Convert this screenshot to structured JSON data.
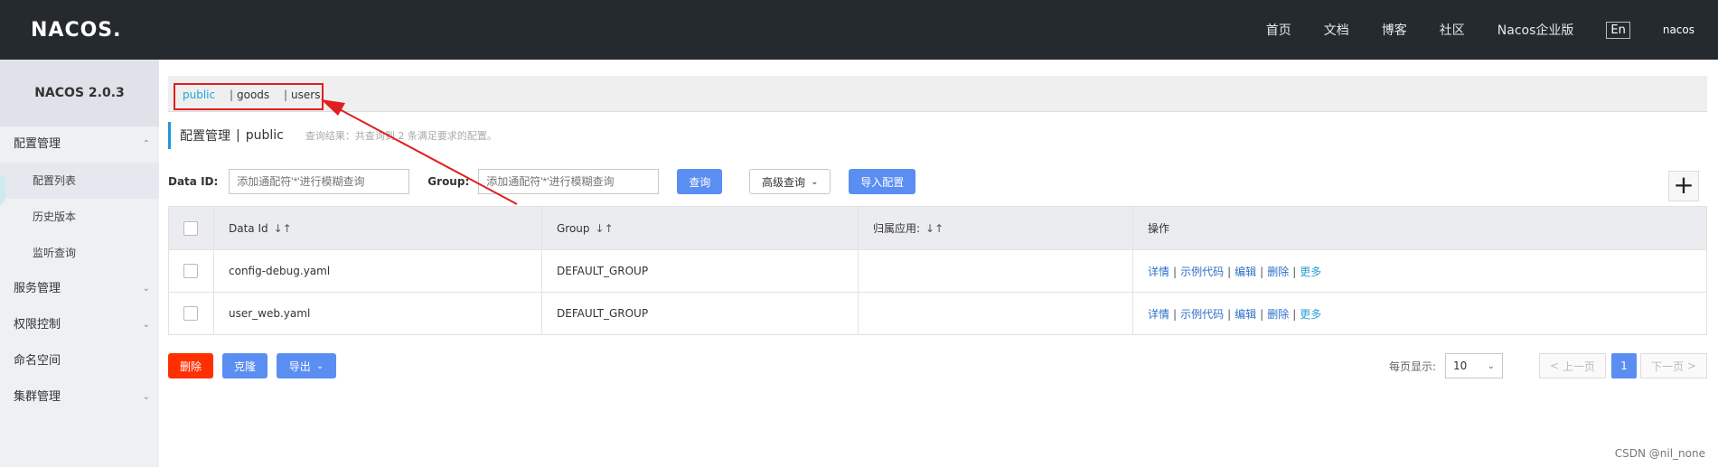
{
  "topbar": {
    "logo": "NACOS.",
    "nav": [
      "首页",
      "文档",
      "博客",
      "社区",
      "Nacos企业版"
    ],
    "lang": "En",
    "user": "nacos"
  },
  "sidebar": {
    "version": "NACOS 2.0.3",
    "config_group": "配置管理",
    "config_items": [
      "配置列表",
      "历史版本",
      "监听查询"
    ],
    "service": "服务管理",
    "auth": "权限控制",
    "namespace": "命名空间",
    "cluster": "集群管理"
  },
  "namespaces": {
    "active": "public",
    "others": [
      "goods",
      "users"
    ]
  },
  "title": {
    "main": "配置管理",
    "sep": "|",
    "ns": "public",
    "hint": "查询结果：共查询到 2 条满足要求的配置。"
  },
  "search": {
    "dataid_label": "Data ID:",
    "dataid_placeholder": "添加通配符'*'进行模糊查询",
    "group_label": "Group:",
    "group_placeholder": "添加通配符'*'进行模糊查询",
    "query_btn": "查询",
    "advanced_btn": "高级查询",
    "import_btn": "导入配置"
  },
  "table": {
    "headers": [
      "Data Id",
      "Group",
      "归属应用:",
      "操作"
    ],
    "rows": [
      {
        "dataid": "config-debug.yaml",
        "group": "DEFAULT_GROUP",
        "app": ""
      },
      {
        "dataid": "user_web.yaml",
        "group": "DEFAULT_GROUP",
        "app": ""
      }
    ],
    "ops": [
      "详情",
      "示例代码",
      "编辑",
      "删除",
      "更多"
    ]
  },
  "bottom": {
    "delete_btn": "删除",
    "clone_btn": "克隆",
    "export_btn": "导出",
    "page_size_label": "每页显示:",
    "page_size": "10",
    "prev": "上一页",
    "current_page": "1",
    "next": "下一页"
  },
  "watermark": "CSDN @nil_none",
  "colors": {
    "topbar": "#252a2f",
    "accent_blue": "#5b8ef2",
    "danger": "#ff3000",
    "highlight_box": "#e02020"
  }
}
